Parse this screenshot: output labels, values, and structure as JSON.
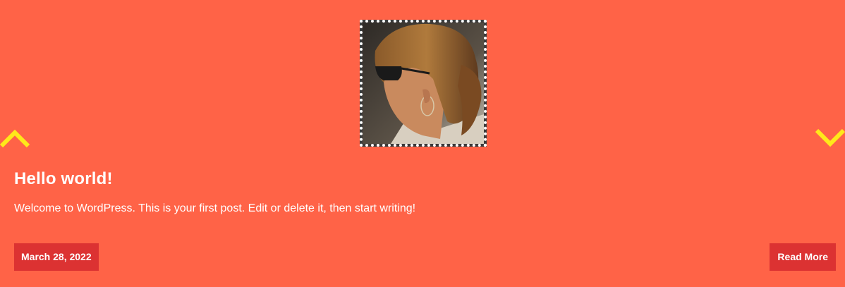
{
  "slider": {
    "prev_icon": "chevron-up-icon",
    "next_icon": "chevron-down-icon",
    "arrow_color": "#ffe81a"
  },
  "post": {
    "thumbnail_alt": "",
    "title": "Hello world!",
    "excerpt": "Welcome to WordPress. This is your first post. Edit or delete it, then start writing!",
    "date": "March 28, 2022",
    "read_more_label": "Read More"
  },
  "colors": {
    "background": "#ff6347",
    "badge": "#dc3232",
    "text": "#ffffff"
  }
}
